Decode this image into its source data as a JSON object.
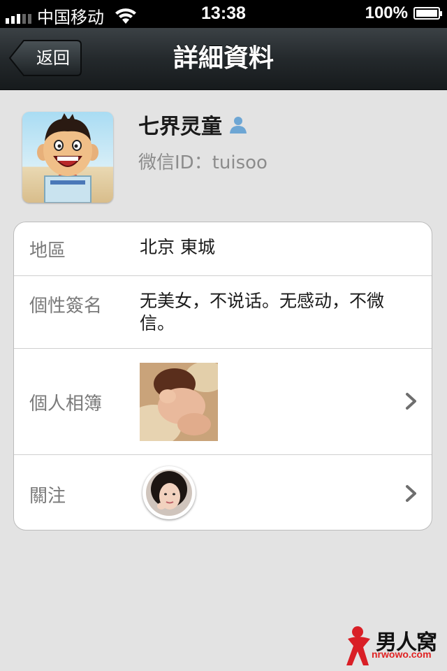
{
  "status_bar": {
    "carrier": "中国移动",
    "time": "13:38",
    "battery": "100%"
  },
  "nav": {
    "back_label": "返回",
    "title": "詳細資料"
  },
  "profile": {
    "name": "七界灵童",
    "wechat_id": "微信ID：tuisoo"
  },
  "details": {
    "region_label": "地區",
    "region_value": "北京 東城",
    "signature_label": "個性簽名",
    "signature_value": "无美女，不说话。无感动，不微信。",
    "album_label": "個人相簿",
    "follow_label": "關注"
  },
  "watermark": {
    "brand": "男人窝",
    "url": "nrwowo.com"
  }
}
